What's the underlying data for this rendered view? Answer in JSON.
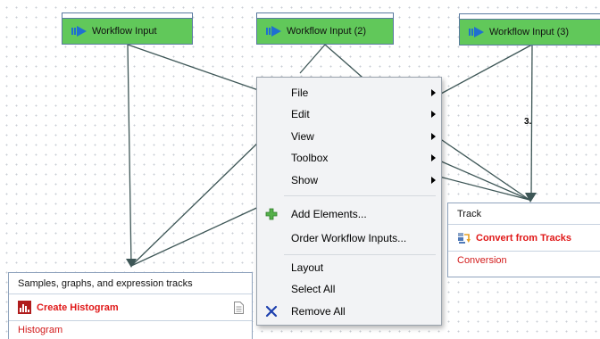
{
  "canvas": {
    "workflow_inputs": [
      {
        "label": "Workflow Input"
      },
      {
        "label": "Workflow Input (2)"
      },
      {
        "label": "Workflow Input (3)"
      }
    ],
    "step_label": "3.",
    "track_box": {
      "header": "Track",
      "tool": "Convert from Tracks",
      "output": "Conversion"
    },
    "histogram_box": {
      "header": "Samples, graphs, and expression tracks",
      "tool": "Create Histogram",
      "output": "Histogram"
    }
  },
  "context_menu": {
    "items": [
      {
        "label": "File",
        "submenu": true
      },
      {
        "label": "Edit",
        "submenu": true
      },
      {
        "label": "View",
        "submenu": true
      },
      {
        "label": "Toolbox",
        "submenu": true
      },
      {
        "label": "Show",
        "submenu": true
      },
      {
        "label": "Add Elements...",
        "icon": "green-plus-icon"
      },
      {
        "label": "Order Workflow Inputs..."
      },
      {
        "label": "Layout"
      },
      {
        "label": "Select All"
      },
      {
        "label": "Remove All",
        "icon": "blue-x-icon"
      }
    ]
  },
  "colors": {
    "input_fill": "#61c85a",
    "connector": "#3d5656",
    "tool_text": "#e01818",
    "menu_bg": "#f2f3f5"
  }
}
